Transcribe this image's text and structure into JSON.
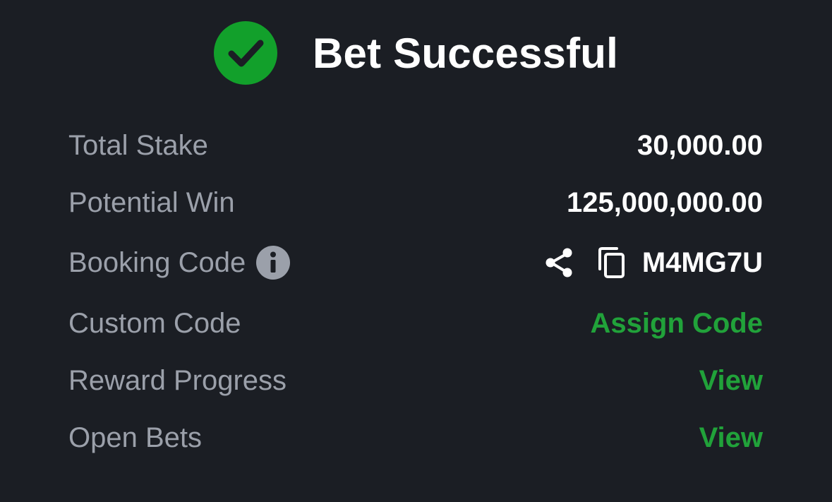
{
  "header": {
    "title": "Bet Successful",
    "success_color": "#12a02b",
    "icon": "check-circle-icon"
  },
  "details": {
    "total_stake": {
      "label": "Total Stake",
      "value": "30,000.00"
    },
    "potential_win": {
      "label": "Potential Win",
      "value": "125,000,000.00"
    },
    "booking_code": {
      "label": "Booking Code",
      "value": "M4MG7U",
      "info_icon": "info-icon",
      "share_icon": "share-icon",
      "copy_icon": "copy-icon"
    },
    "custom_code": {
      "label": "Custom Code",
      "action": "Assign Code"
    },
    "reward_progress": {
      "label": "Reward Progress",
      "action": "View"
    },
    "open_bets": {
      "label": "Open Bets",
      "action": "View"
    }
  },
  "colors": {
    "background": "#1b1e24",
    "label": "#9ba0aa",
    "value": "#ffffff",
    "link": "#21a23a"
  }
}
